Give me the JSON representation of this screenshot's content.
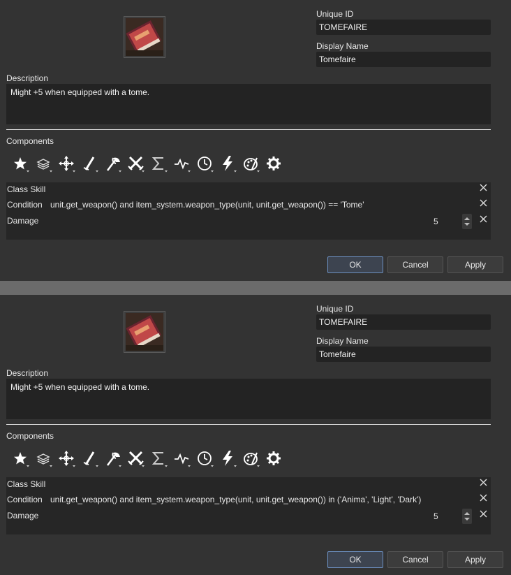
{
  "panels": [
    {
      "unique_id_label": "Unique ID",
      "unique_id_value": "TOMEFAIRE",
      "display_name_label": "Display Name",
      "display_name_value": "Tomefaire",
      "description_label": "Description",
      "description_value": "Might +5 when equipped with a tome.",
      "components_label": "Components",
      "components": {
        "class_skill": "Class Skill",
        "condition_label": "Condition",
        "condition_value": "unit.get_weapon() and item_system.weapon_type(unit, unit.get_weapon()) == 'Tome'",
        "damage_label": "Damage",
        "damage_value": "5"
      },
      "buttons": {
        "ok": "OK",
        "cancel": "Cancel",
        "apply": "Apply"
      }
    },
    {
      "unique_id_label": "Unique ID",
      "unique_id_value": "TOMEFAIRE",
      "display_name_label": "Display Name",
      "display_name_value": "Tomefaire",
      "description_label": "Description",
      "description_value": "Might +5 when equipped with a tome.",
      "components_label": "Components",
      "components": {
        "class_skill": "Class Skill",
        "condition_label": "Condition",
        "condition_value": "unit.get_weapon() and item_system.weapon_type(unit, unit.get_weapon()) in ('Anima', 'Light', 'Dark')",
        "damage_label": "Damage",
        "damage_value": "5"
      },
      "buttons": {
        "ok": "OK",
        "cancel": "Cancel",
        "apply": "Apply"
      }
    }
  ],
  "toolbar_icons": [
    "star-icon",
    "layers-icon",
    "move-icon",
    "sword-icon",
    "axe-icon",
    "crossed-swords-icon",
    "sigma-icon",
    "pulse-icon",
    "clock-icon",
    "lightning-icon",
    "palette-icon",
    "gear-icon"
  ],
  "colors": {
    "panel_bg": "#333333",
    "field_bg": "#232323",
    "ok_border": "#6c8fc0"
  }
}
